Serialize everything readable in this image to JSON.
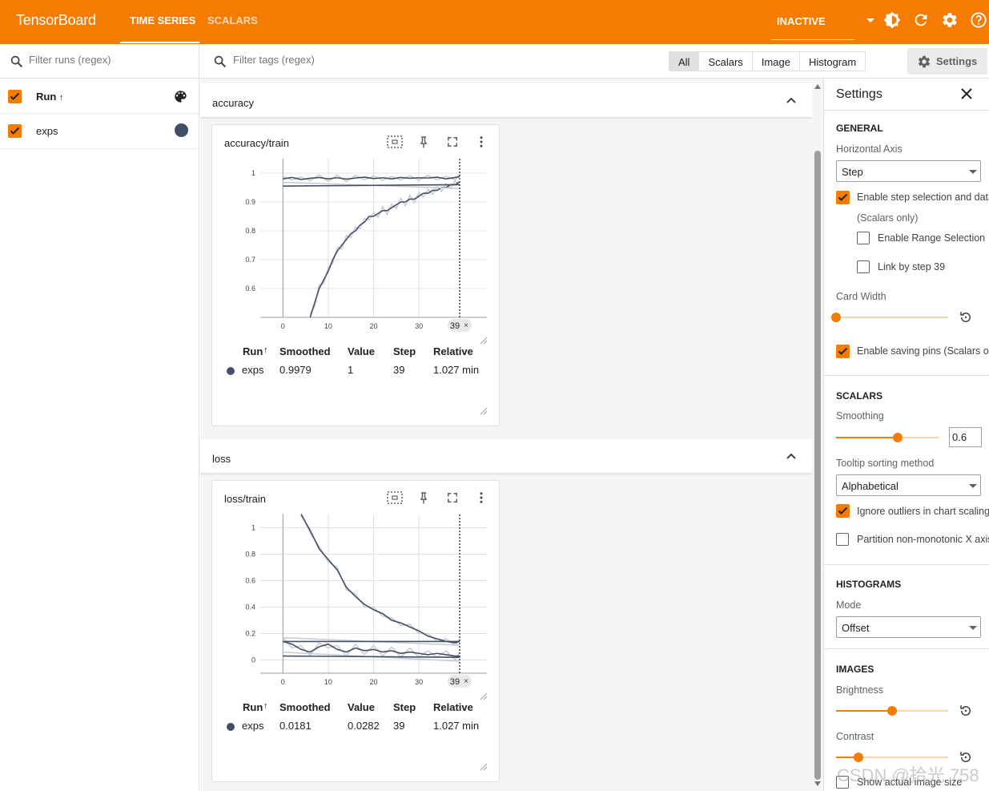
{
  "header": {
    "brand": "TensorBoard",
    "tabs": [
      {
        "label": "TIME SERIES",
        "active": true
      },
      {
        "label": "SCALARS",
        "active": false
      }
    ],
    "status": "INACTIVE",
    "accent_color": "#f57c00"
  },
  "runs": {
    "filter_placeholder": "Filter runs (regex)",
    "column_label": "Run",
    "sort_indicator": "↑",
    "items": [
      {
        "name": "exps",
        "checked": true,
        "color": "#425066"
      }
    ]
  },
  "tags": {
    "filter_placeholder": "Filter tags (regex)",
    "types": [
      "All",
      "Scalars",
      "Image",
      "Histogram"
    ],
    "selected_type": "All",
    "settings_button": "Settings"
  },
  "groups": [
    {
      "name": "accuracy",
      "card": {
        "title": "accuracy/train",
        "chart_data": {
          "type": "line",
          "x_label": "",
          "y_label": "",
          "x_ticks": [
            0,
            10,
            20,
            30
          ],
          "y_ticks": [
            0.6,
            0.7,
            0.8,
            0.9,
            1
          ],
          "xlim": [
            -5,
            45
          ],
          "ylim": [
            0.5,
            1.05
          ],
          "step_marker": 39,
          "series": [
            {
              "name": "exps",
              "smoothed": true,
              "x": [
                0,
                2,
                4,
                6,
                8,
                10,
                12,
                14,
                16,
                18,
                20,
                22,
                24,
                26,
                28,
                30,
                32,
                34,
                36,
                38,
                39
              ],
              "values": [
                0.98,
                0.985,
                0.978,
                0.982,
                0.985,
                0.98,
                0.984,
                0.979,
                0.983,
                0.986,
                0.981,
                0.984,
                0.98,
                0.985,
                0.982,
                0.984,
                0.983,
                0.986,
                0.98,
                0.985,
                0.988
              ]
            },
            {
              "name": "exps",
              "smoothed": true,
              "x": [
                6,
                7,
                8,
                9,
                10,
                11,
                12,
                13,
                14,
                15,
                16,
                17,
                18,
                19,
                20,
                21,
                22,
                23,
                24,
                25,
                26,
                27,
                28,
                29,
                30,
                31,
                32,
                33,
                34,
                35,
                36,
                37,
                38,
                39
              ],
              "values": [
                0.5,
                0.55,
                0.6,
                0.63,
                0.66,
                0.7,
                0.73,
                0.75,
                0.77,
                0.79,
                0.8,
                0.82,
                0.83,
                0.85,
                0.85,
                0.86,
                0.87,
                0.87,
                0.88,
                0.89,
                0.9,
                0.9,
                0.91,
                0.91,
                0.92,
                0.93,
                0.93,
                0.94,
                0.94,
                0.95,
                0.95,
                0.96,
                0.96,
                0.97
              ]
            },
            {
              "name": "exps",
              "smoothed": true,
              "x": [
                0,
                39
              ],
              "values": [
                0.955,
                0.96
              ]
            }
          ]
        },
        "table": {
          "headers": [
            "Run",
            "Smoothed",
            "Value",
            "Step",
            "Relative"
          ],
          "rows": [
            {
              "run": "exps",
              "smoothed": "0.9979",
              "value": "1",
              "step": "39",
              "relative": "1.027 min"
            }
          ]
        },
        "step_badge": "39"
      }
    },
    {
      "name": "loss",
      "card": {
        "title": "loss/train",
        "chart_data": {
          "type": "line",
          "x_label": "",
          "y_label": "",
          "x_ticks": [
            0,
            10,
            20,
            30
          ],
          "y_ticks": [
            0,
            0.2,
            0.4,
            0.6,
            0.8,
            1
          ],
          "xlim": [
            -5,
            45
          ],
          "ylim": [
            -0.1,
            1.1
          ],
          "step_marker": 39,
          "series": [
            {
              "name": "exps",
              "smoothed": true,
              "x": [
                4,
                6,
                8,
                10,
                12,
                14,
                16,
                18,
                20,
                22,
                24,
                26,
                28,
                30,
                32,
                34,
                36,
                38,
                39
              ],
              "values": [
                1.1,
                0.98,
                0.84,
                0.76,
                0.68,
                0.55,
                0.48,
                0.42,
                0.38,
                0.35,
                0.3,
                0.28,
                0.25,
                0.22,
                0.18,
                0.16,
                0.14,
                0.13,
                0.14
              ]
            },
            {
              "name": "exps",
              "smoothed": true,
              "x": [
                0,
                2,
                4,
                6,
                8,
                10,
                12,
                14,
                16,
                18,
                20,
                22,
                24,
                26,
                28,
                30,
                32,
                34,
                36,
                38,
                39
              ],
              "values": [
                0.14,
                0.12,
                0.08,
                0.06,
                0.1,
                0.12,
                0.08,
                0.06,
                0.09,
                0.07,
                0.08,
                0.06,
                0.07,
                0.05,
                0.06,
                0.05,
                0.04,
                0.05,
                0.04,
                0.03,
                0.03
              ]
            },
            {
              "name": "exps",
              "smoothed": true,
              "x": [
                0,
                39
              ],
              "values": [
                0.14,
                0.14
              ]
            },
            {
              "name": "exps",
              "smoothed": true,
              "x": [
                0,
                39
              ],
              "values": [
                0.03,
                0.02
              ]
            }
          ]
        },
        "table": {
          "headers": [
            "Run",
            "Smoothed",
            "Value",
            "Step",
            "Relative"
          ],
          "rows": [
            {
              "run": "exps",
              "smoothed": "0.0181",
              "value": "0.0282",
              "step": "39",
              "relative": "1.027 min"
            }
          ]
        },
        "step_badge": "39"
      }
    }
  ],
  "settings": {
    "title": "Settings",
    "general": {
      "heading": "GENERAL",
      "horizontal_axis_label": "Horizontal Axis",
      "horizontal_axis_value": "Step",
      "step_selection_label": "Enable step selection and data",
      "scalars_only": "(Scalars only)",
      "range_selection_label": "Enable Range Selection",
      "link_step_label": "Link by step 39",
      "card_width_label": "Card Width",
      "card_width_level": 0,
      "saving_pins_label": "Enable saving pins (Scalars o"
    },
    "scalars": {
      "heading": "SCALARS",
      "smoothing_label": "Smoothing",
      "smoothing_value": "0.6",
      "tooltip_sort_label": "Tooltip sorting method",
      "tooltip_sort_value": "Alphabetical",
      "ignore_outliers_label": "Ignore outliers in chart scaling",
      "partition_label": "Partition non-monotonic X axis"
    },
    "histograms": {
      "heading": "HISTOGRAMS",
      "mode_label": "Mode",
      "mode_value": "Offset"
    },
    "images": {
      "heading": "IMAGES",
      "brightness_label": "Brightness",
      "brightness_level": 0.5,
      "contrast_label": "Contrast",
      "contrast_level": 0.2,
      "actual_size_label": "Show actual image size"
    }
  },
  "watermark": "CSDN @拾光 758"
}
